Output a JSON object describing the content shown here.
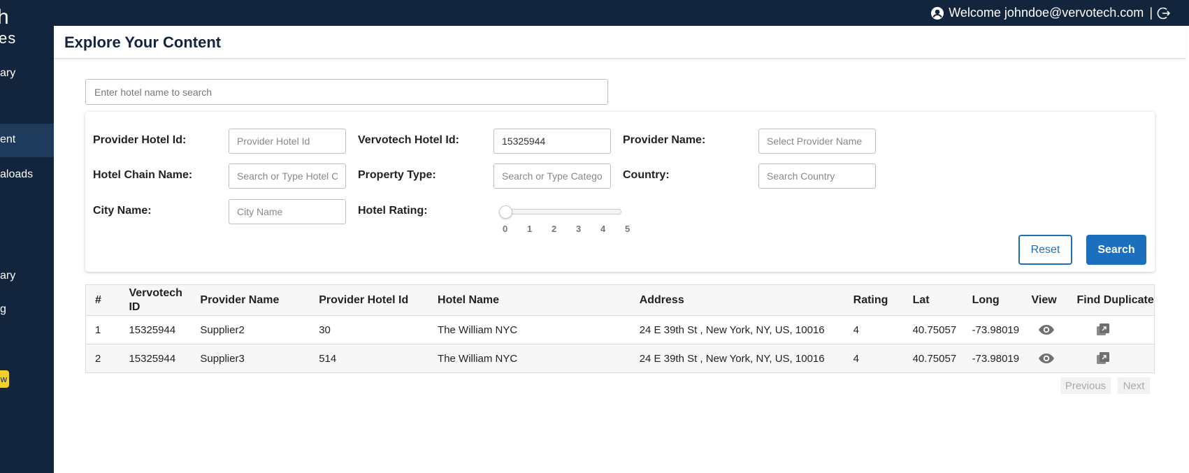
{
  "header": {
    "welcome_text": "Welcome johndoe@vervotech.com",
    "separator": "|"
  },
  "sidebar": {
    "logo_fragment_top": "h",
    "logo_fragment_bottom": "es",
    "items": [
      {
        "label": "ary",
        "active": false
      },
      {
        "label": "ent",
        "active": true
      },
      {
        "label": "aloads",
        "active": false
      },
      {
        "label": "ary",
        "active": false
      },
      {
        "label": "g",
        "active": false
      }
    ],
    "badge": "w"
  },
  "page": {
    "title": "Explore Your Content"
  },
  "search": {
    "placeholder": "Enter hotel name to search",
    "value": ""
  },
  "filters": {
    "provider_hotel_id": {
      "label": "Provider Hotel Id:",
      "placeholder": "Provider Hotel Id",
      "value": ""
    },
    "vervotech_hotel_id": {
      "label": "Vervotech Hotel Id:",
      "placeholder": "",
      "value": "15325944"
    },
    "provider_name": {
      "label": "Provider Name:",
      "placeholder": "Select Provider Name",
      "value": ""
    },
    "hotel_chain_name": {
      "label": "Hotel Chain Name:",
      "placeholder": "Search or Type Hotel Chain",
      "value": ""
    },
    "property_type": {
      "label": "Property Type:",
      "placeholder": "Search or Type Category",
      "value": ""
    },
    "country": {
      "label": "Country:",
      "placeholder": "Search Country",
      "value": ""
    },
    "city_name": {
      "label": "City Name:",
      "placeholder": "City Name",
      "value": ""
    },
    "hotel_rating": {
      "label": "Hotel Rating:",
      "min": 0,
      "max": 5,
      "value": 0,
      "ticks": [
        "0",
        "1",
        "2",
        "3",
        "4",
        "5"
      ]
    }
  },
  "buttons": {
    "reset": "Reset",
    "search": "Search",
    "previous": "Previous",
    "next": "Next"
  },
  "table": {
    "columns": [
      "#",
      "Vervotech ID",
      "Provider Name",
      "Provider Hotel Id",
      "Hotel Name",
      "Address",
      "Rating",
      "Lat",
      "Long",
      "View",
      "Find Duplicate"
    ],
    "rows": [
      {
        "num": "1",
        "vervotech_id": "15325944",
        "provider_name": "Supplier2",
        "provider_hotel_id": "30",
        "hotel_name": "The William NYC",
        "address": "24 E 39th St , New York, NY, US, 10016",
        "rating": "4",
        "lat": "40.75057",
        "long": "-73.98019"
      },
      {
        "num": "2",
        "vervotech_id": "15325944",
        "provider_name": "Supplier3",
        "provider_hotel_id": "514",
        "hotel_name": "The William NYC",
        "address": "24 E 39th St , New York, NY, US, 10016",
        "rating": "4",
        "lat": "40.75057",
        "long": "-73.98019"
      }
    ]
  },
  "icons": {
    "user": "user-circle-icon",
    "logout": "logout-icon",
    "view": "eye-icon",
    "duplicate": "duplicate-icon"
  },
  "colors": {
    "navy": "#13243d",
    "accent_blue": "#1b6fbd",
    "badge_yellow": "#f2d12a"
  }
}
